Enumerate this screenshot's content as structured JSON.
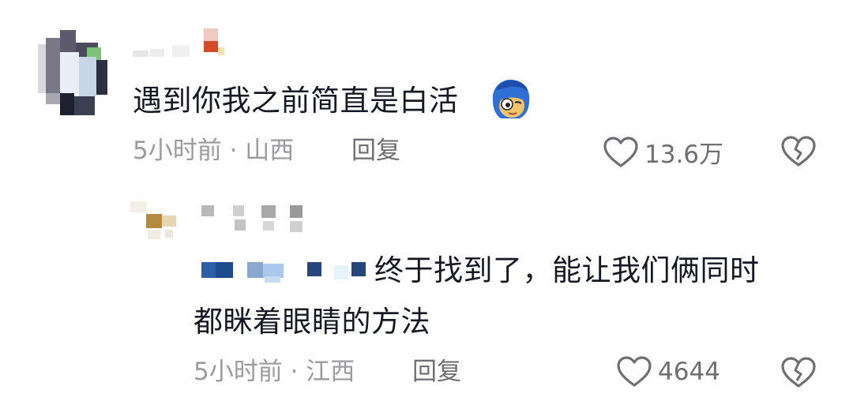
{
  "comments": [
    {
      "text": "遇到你我之前简直是白活",
      "emoji": "blue-hair-face-emoji",
      "meta": "5小时前 · 山西",
      "reply_label": "回复",
      "likes": "13.6万"
    }
  ],
  "reply": {
    "text_line1": "终于找到了，能让我们俩同时",
    "text_line2": "都眯着眼睛的方法",
    "meta": "5小时前 · 江西",
    "reply_label": "回复",
    "likes": "4644"
  },
  "icons": {
    "like": "heart-outline-icon",
    "dislike": "broken-heart-icon"
  },
  "colors": {
    "text": "#161823",
    "meta": "#9a9a9f",
    "action": "#6e6e73"
  }
}
